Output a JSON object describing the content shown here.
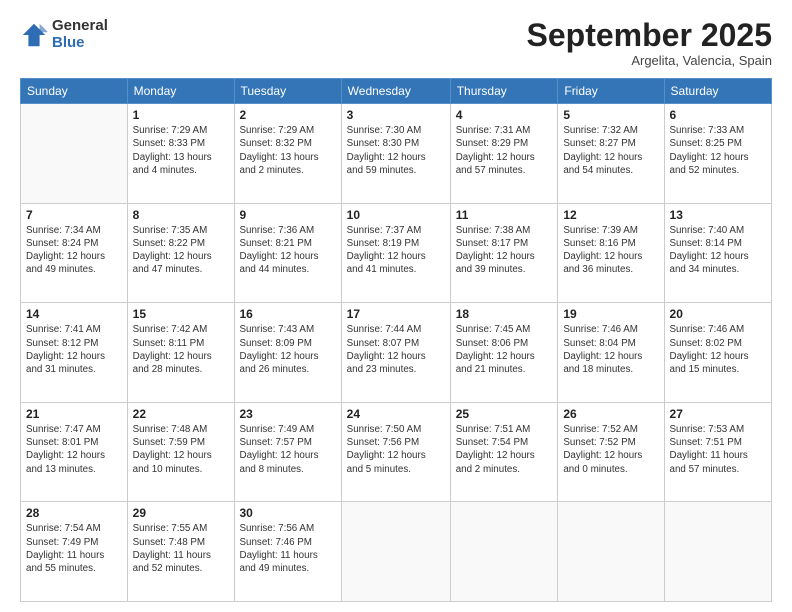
{
  "logo": {
    "general": "General",
    "blue": "Blue"
  },
  "header": {
    "month": "September 2025",
    "location": "Argelita, Valencia, Spain"
  },
  "weekdays": [
    "Sunday",
    "Monday",
    "Tuesday",
    "Wednesday",
    "Thursday",
    "Friday",
    "Saturday"
  ],
  "weeks": [
    [
      {
        "day": "",
        "info": ""
      },
      {
        "day": "1",
        "info": "Sunrise: 7:29 AM\nSunset: 8:33 PM\nDaylight: 13 hours\nand 4 minutes."
      },
      {
        "day": "2",
        "info": "Sunrise: 7:29 AM\nSunset: 8:32 PM\nDaylight: 13 hours\nand 2 minutes."
      },
      {
        "day": "3",
        "info": "Sunrise: 7:30 AM\nSunset: 8:30 PM\nDaylight: 12 hours\nand 59 minutes."
      },
      {
        "day": "4",
        "info": "Sunrise: 7:31 AM\nSunset: 8:29 PM\nDaylight: 12 hours\nand 57 minutes."
      },
      {
        "day": "5",
        "info": "Sunrise: 7:32 AM\nSunset: 8:27 PM\nDaylight: 12 hours\nand 54 minutes."
      },
      {
        "day": "6",
        "info": "Sunrise: 7:33 AM\nSunset: 8:25 PM\nDaylight: 12 hours\nand 52 minutes."
      }
    ],
    [
      {
        "day": "7",
        "info": "Sunrise: 7:34 AM\nSunset: 8:24 PM\nDaylight: 12 hours\nand 49 minutes."
      },
      {
        "day": "8",
        "info": "Sunrise: 7:35 AM\nSunset: 8:22 PM\nDaylight: 12 hours\nand 47 minutes."
      },
      {
        "day": "9",
        "info": "Sunrise: 7:36 AM\nSunset: 8:21 PM\nDaylight: 12 hours\nand 44 minutes."
      },
      {
        "day": "10",
        "info": "Sunrise: 7:37 AM\nSunset: 8:19 PM\nDaylight: 12 hours\nand 41 minutes."
      },
      {
        "day": "11",
        "info": "Sunrise: 7:38 AM\nSunset: 8:17 PM\nDaylight: 12 hours\nand 39 minutes."
      },
      {
        "day": "12",
        "info": "Sunrise: 7:39 AM\nSunset: 8:16 PM\nDaylight: 12 hours\nand 36 minutes."
      },
      {
        "day": "13",
        "info": "Sunrise: 7:40 AM\nSunset: 8:14 PM\nDaylight: 12 hours\nand 34 minutes."
      }
    ],
    [
      {
        "day": "14",
        "info": "Sunrise: 7:41 AM\nSunset: 8:12 PM\nDaylight: 12 hours\nand 31 minutes."
      },
      {
        "day": "15",
        "info": "Sunrise: 7:42 AM\nSunset: 8:11 PM\nDaylight: 12 hours\nand 28 minutes."
      },
      {
        "day": "16",
        "info": "Sunrise: 7:43 AM\nSunset: 8:09 PM\nDaylight: 12 hours\nand 26 minutes."
      },
      {
        "day": "17",
        "info": "Sunrise: 7:44 AM\nSunset: 8:07 PM\nDaylight: 12 hours\nand 23 minutes."
      },
      {
        "day": "18",
        "info": "Sunrise: 7:45 AM\nSunset: 8:06 PM\nDaylight: 12 hours\nand 21 minutes."
      },
      {
        "day": "19",
        "info": "Sunrise: 7:46 AM\nSunset: 8:04 PM\nDaylight: 12 hours\nand 18 minutes."
      },
      {
        "day": "20",
        "info": "Sunrise: 7:46 AM\nSunset: 8:02 PM\nDaylight: 12 hours\nand 15 minutes."
      }
    ],
    [
      {
        "day": "21",
        "info": "Sunrise: 7:47 AM\nSunset: 8:01 PM\nDaylight: 12 hours\nand 13 minutes."
      },
      {
        "day": "22",
        "info": "Sunrise: 7:48 AM\nSunset: 7:59 PM\nDaylight: 12 hours\nand 10 minutes."
      },
      {
        "day": "23",
        "info": "Sunrise: 7:49 AM\nSunset: 7:57 PM\nDaylight: 12 hours\nand 8 minutes."
      },
      {
        "day": "24",
        "info": "Sunrise: 7:50 AM\nSunset: 7:56 PM\nDaylight: 12 hours\nand 5 minutes."
      },
      {
        "day": "25",
        "info": "Sunrise: 7:51 AM\nSunset: 7:54 PM\nDaylight: 12 hours\nand 2 minutes."
      },
      {
        "day": "26",
        "info": "Sunrise: 7:52 AM\nSunset: 7:52 PM\nDaylight: 12 hours\nand 0 minutes."
      },
      {
        "day": "27",
        "info": "Sunrise: 7:53 AM\nSunset: 7:51 PM\nDaylight: 11 hours\nand 57 minutes."
      }
    ],
    [
      {
        "day": "28",
        "info": "Sunrise: 7:54 AM\nSunset: 7:49 PM\nDaylight: 11 hours\nand 55 minutes."
      },
      {
        "day": "29",
        "info": "Sunrise: 7:55 AM\nSunset: 7:48 PM\nDaylight: 11 hours\nand 52 minutes."
      },
      {
        "day": "30",
        "info": "Sunrise: 7:56 AM\nSunset: 7:46 PM\nDaylight: 11 hours\nand 49 minutes."
      },
      {
        "day": "",
        "info": ""
      },
      {
        "day": "",
        "info": ""
      },
      {
        "day": "",
        "info": ""
      },
      {
        "day": "",
        "info": ""
      }
    ]
  ]
}
